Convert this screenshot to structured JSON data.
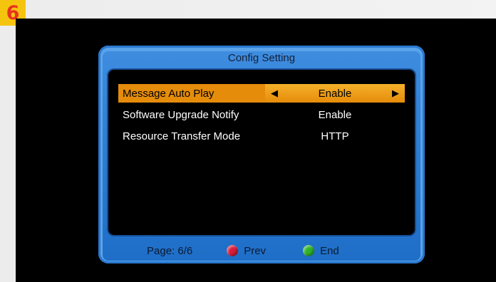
{
  "step_badge": "6",
  "window": {
    "title": "Config Setting"
  },
  "settings": [
    {
      "label": "Message Auto Play",
      "value": "Enable",
      "selected": true
    },
    {
      "label": "Software Upgrade Notify",
      "value": "Enable",
      "selected": false
    },
    {
      "label": "Resource Transfer Mode",
      "value": "HTTP",
      "selected": false
    }
  ],
  "footer": {
    "page": "Page: 6/6",
    "prev_label": "Prev",
    "end_label": "End"
  },
  "colors": {
    "panel_blue": "#2f7fd6",
    "highlight_orange": "#e58c0b",
    "prev_red": "#d81c3c",
    "end_green": "#2fb32a"
  },
  "icons": [
    "arrow-left-icon",
    "arrow-right-icon",
    "red-button-icon",
    "green-button-icon"
  ]
}
